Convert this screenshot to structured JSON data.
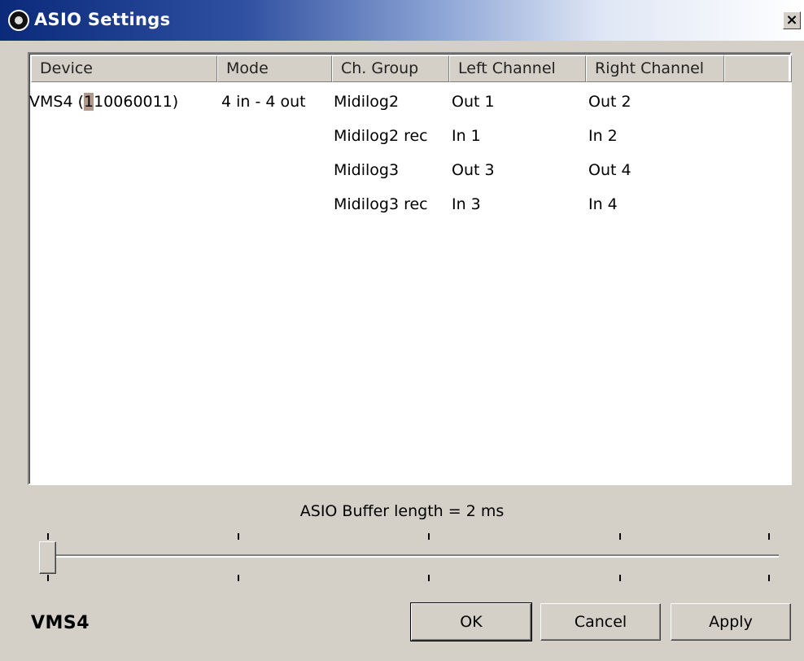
{
  "window": {
    "title": "ASIO Settings",
    "close_glyph": "×"
  },
  "list": {
    "columns": [
      "Device",
      "Mode",
      "Ch. Group",
      "Left Channel",
      "Right Channel"
    ],
    "device": {
      "name_prefix": "VMS4 (",
      "serial_highlight": "1",
      "serial_rest": "10060011)",
      "mode": "4 in - 4 out"
    },
    "rows": [
      {
        "group": "Midilog2",
        "left": "Out 1",
        "right": "Out 2"
      },
      {
        "group": "Midilog2 rec",
        "left": "In 1",
        "right": "In 2"
      },
      {
        "group": "Midilog3",
        "left": "Out 3",
        "right": "Out 4"
      },
      {
        "group": "Midilog3 rec",
        "left": "In 3",
        "right": "In 4"
      }
    ]
  },
  "buffer": {
    "label": "ASIO Buffer length = 2 ms",
    "slider_position": 0.0
  },
  "footer": {
    "brand": "VMS4",
    "ok_label": "OK",
    "cancel_label": "Cancel",
    "apply_label": "Apply"
  },
  "icons": {
    "app": "speaker-icon",
    "close": "close-icon"
  }
}
